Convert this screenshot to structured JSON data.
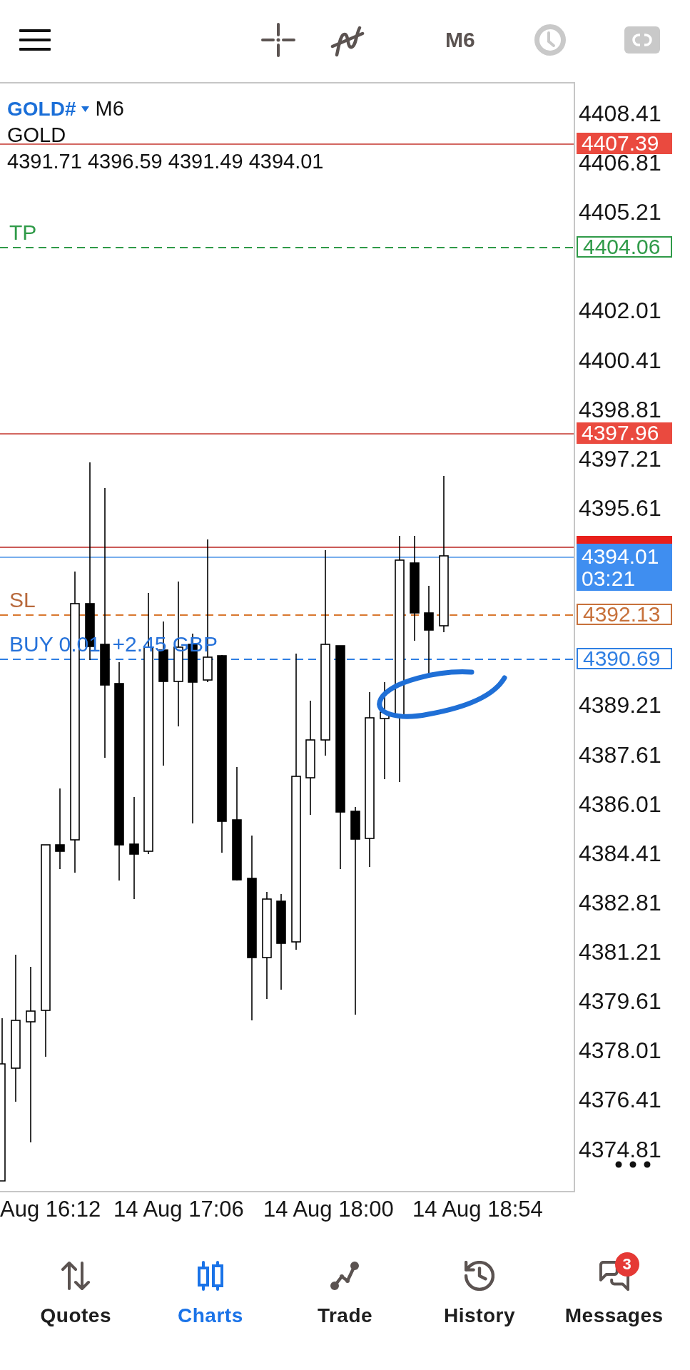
{
  "toolbar": {
    "tools": [
      {
        "kind": "crosshair",
        "disabled": false
      },
      {
        "kind": "indicators",
        "disabled": false
      },
      {
        "kind": "timeframe",
        "label": "M6",
        "disabled": false
      },
      {
        "kind": "clock",
        "disabled": true
      },
      {
        "kind": "one_click",
        "disabled": true
      }
    ]
  },
  "chart": {
    "symbol": "GOLD#",
    "timeframe": "M6",
    "description": "GOLD",
    "ohlc": "4391.71 4396.59 4391.49 4394.01",
    "lines": [
      {
        "kind": "level",
        "price": "4407.39"
      },
      {
        "kind": "take_profit",
        "label": "TP",
        "price": "4404.06"
      },
      {
        "kind": "level",
        "price": "4397.96"
      },
      {
        "kind": "ask"
      },
      {
        "kind": "bid",
        "price": "4394.01",
        "countdown": "03:21"
      },
      {
        "kind": "stop_loss",
        "label": "SL",
        "price": "4392.13"
      },
      {
        "kind": "position",
        "label": "BUY 0.01  +2.45 GBP",
        "price": "4390.69"
      }
    ],
    "price_axis": [
      "4408.41",
      "4406.81",
      "4405.21",
      "4402.01",
      "4400.41",
      "4398.81",
      "4397.21",
      "4395.61",
      "4389.21",
      "4387.61",
      "4386.01",
      "4384.41",
      "4382.81",
      "4381.21",
      "4379.61",
      "4378.01",
      "4376.41",
      "4374.81"
    ],
    "time_axis": [
      "Aug 16:12",
      "14 Aug 17:06",
      "14 Aug 18:00",
      "14 Aug 18:54"
    ]
  },
  "nav": [
    {
      "kind": "quotes",
      "label": "Quotes",
      "selected": false
    },
    {
      "kind": "charts",
      "label": "Charts",
      "selected": true
    },
    {
      "kind": "trade",
      "label": "Trade",
      "selected": false
    },
    {
      "kind": "history",
      "label": "History",
      "selected": false
    },
    {
      "kind": "messages",
      "label": "Messages",
      "selected": false,
      "badge": "3"
    }
  ]
}
